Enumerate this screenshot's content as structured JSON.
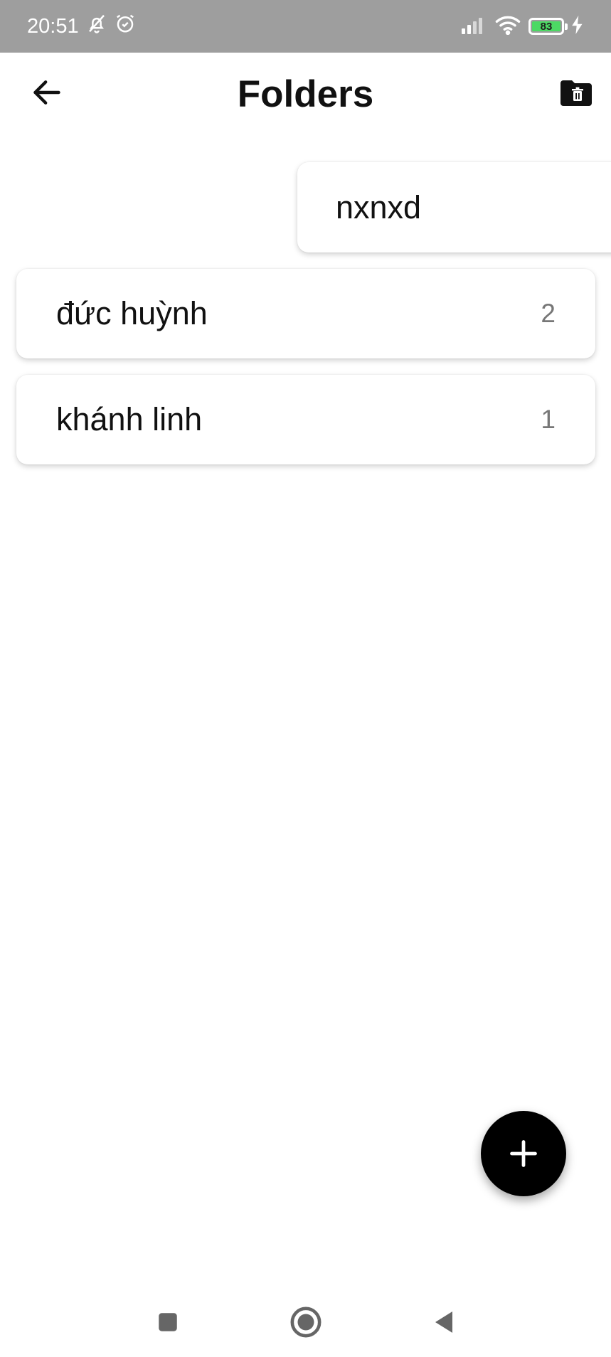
{
  "status_bar": {
    "time": "20:51",
    "battery_level": "83",
    "icons": [
      "muted-bell-icon",
      "alarm-icon",
      "signal-icon",
      "wifi-icon",
      "battery-icon",
      "charging-icon"
    ]
  },
  "header": {
    "title": "Folders",
    "back_icon": "arrow-left-icon",
    "action_icon": "folder-delete-icon"
  },
  "dragging_folder": {
    "name": "nxnxd"
  },
  "folders": [
    {
      "name": "đức huỳnh",
      "count": "2"
    },
    {
      "name": "khánh linh",
      "count": "1"
    }
  ],
  "fab": {
    "icon": "plus-icon"
  },
  "nav": {
    "icons": [
      "recents-square-icon",
      "home-circle-icon",
      "back-triangle-icon"
    ]
  },
  "colors": {
    "status_bar_bg": "#9e9e9e",
    "battery_green": "#4cd964",
    "fab_bg": "#000000",
    "count_gray": "#777777"
  }
}
